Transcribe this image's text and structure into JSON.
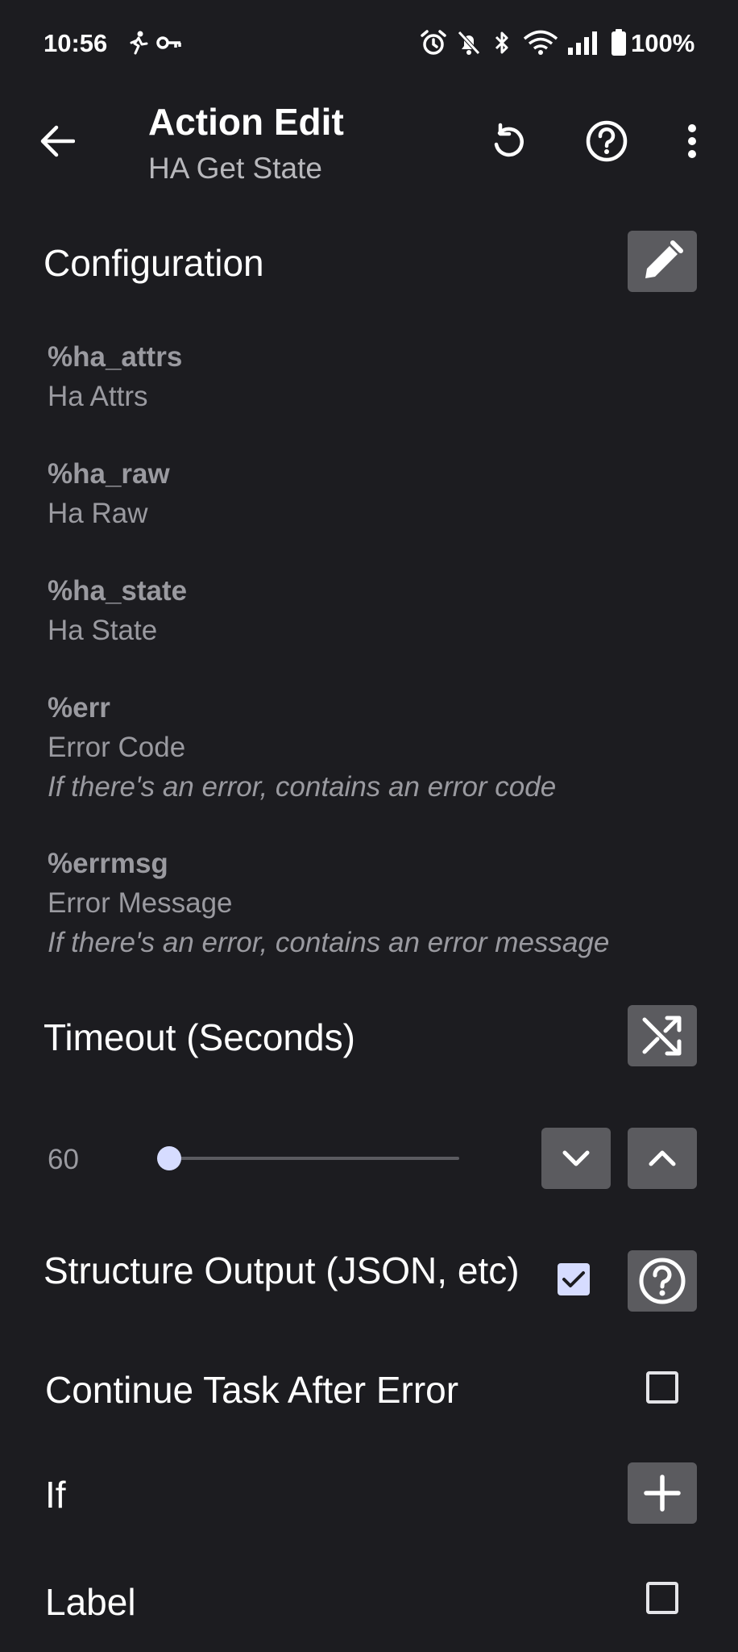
{
  "status_bar": {
    "time": "10:56",
    "battery_text": "100%",
    "icons": [
      "activity-icon",
      "key-icon",
      "alarm-icon",
      "notifications-off-icon",
      "bluetooth-icon",
      "wifi-icon",
      "signal-icon",
      "battery-icon"
    ]
  },
  "toolbar": {
    "title": "Action Edit",
    "subtitle": "HA Get State",
    "icons": [
      "back-arrow-icon",
      "reset-icon",
      "help-icon",
      "overflow-menu-icon"
    ]
  },
  "configuration": {
    "title": "Configuration",
    "icon": "pencil-icon"
  },
  "variables": [
    {
      "name": "%ha_attrs",
      "label": "Ha Attrs",
      "description": ""
    },
    {
      "name": "%ha_raw",
      "label": "Ha Raw",
      "description": ""
    },
    {
      "name": "%ha_state",
      "label": "Ha State",
      "description": ""
    },
    {
      "name": "%err",
      "label": "Error Code",
      "description": "If there's an error, contains an error code"
    },
    {
      "name": "%errmsg",
      "label": "Error Message",
      "description": "If there's an error, contains an error message"
    }
  ],
  "timeout": {
    "title": "Timeout (Seconds)",
    "value": "60",
    "slider_fraction": 0.0,
    "icons": [
      "variable-shuffle-icon",
      "chevron-down-icon",
      "chevron-up-icon"
    ]
  },
  "structure_output": {
    "label": "Structure Output (JSON, etc)",
    "checked": true,
    "icon": "help-icon"
  },
  "continue_after_error": {
    "label": "Continue Task After Error",
    "checked": false
  },
  "if_row": {
    "label": "If",
    "icon": "plus-icon"
  },
  "label_row": {
    "label": "Label",
    "checked": false
  },
  "colors": {
    "background": "#1c1c20",
    "button_gray": "#5b5b5f",
    "muted_text": "#9a9aa0",
    "accent": "#d6dcff"
  }
}
